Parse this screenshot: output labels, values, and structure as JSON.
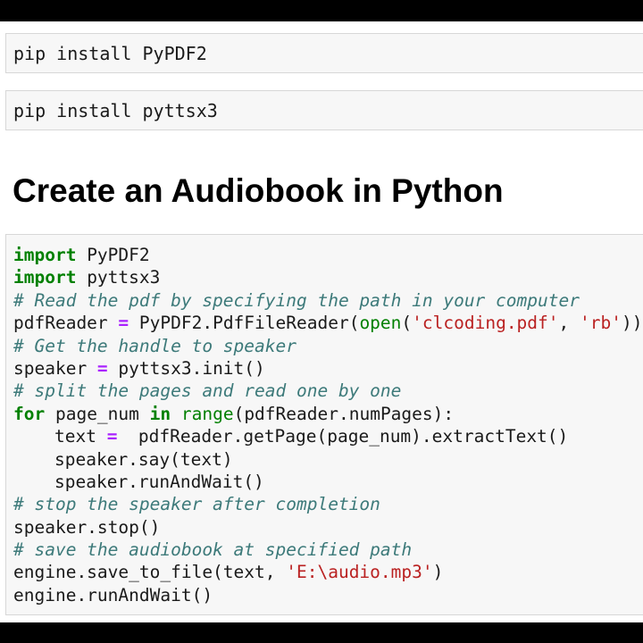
{
  "cells": {
    "cmd1": "pip install PyPDF2",
    "cmd2": "pip install pyttsx3"
  },
  "heading": "Create an Audiobook in Python",
  "code": {
    "l1": {
      "kw": "import",
      "rest": " PyPDF2"
    },
    "l2": {
      "kw": "import",
      "rest": " pyttsx3"
    },
    "l3": {
      "comment": "# Read the pdf by specifying the path in your computer"
    },
    "l4": {
      "a": "pdfReader ",
      "op": "=",
      "b": " PyPDF2.PdfFileReader(",
      "bi": "open",
      "c": "(",
      "s1": "'clcoding.pdf'",
      "d": ", ",
      "s2": "'rb'",
      "e": "))"
    },
    "l5": {
      "comment": "# Get the handle to speaker"
    },
    "l6": {
      "a": "speaker ",
      "op": "=",
      "b": " pyttsx3.init()"
    },
    "l7": {
      "comment": "# split the pages and read one by one"
    },
    "l8": {
      "kw1": "for",
      "a": " page_num ",
      "kw2": "in",
      "b": " ",
      "bi": "range",
      "c": "(pdfReader.numPages):"
    },
    "l9": {
      "a": "text ",
      "op": "=",
      "b": "  pdfReader.getPage(page_num).extractText()"
    },
    "l10": {
      "a": "speaker.say(text)"
    },
    "l11": {
      "a": "speaker.runAndWait()"
    },
    "l12": {
      "comment": "# stop the speaker after completion"
    },
    "l13": {
      "a": "speaker.stop()"
    },
    "l14": {
      "comment": "# save the audiobook at specified path"
    },
    "l15": {
      "a": "engine.save_to_file(text, ",
      "s": "'E:\\audio.mp3'",
      "b": ")"
    },
    "l16": {
      "a": "engine.runAndWait()"
    }
  },
  "colors": {
    "keyword": "#008000",
    "comment": "#3d7a7a",
    "string": "#ba2121",
    "operator": "#aa22ff",
    "cell_background": "#f7f7f7",
    "cell_border": "#d7d7d7"
  }
}
